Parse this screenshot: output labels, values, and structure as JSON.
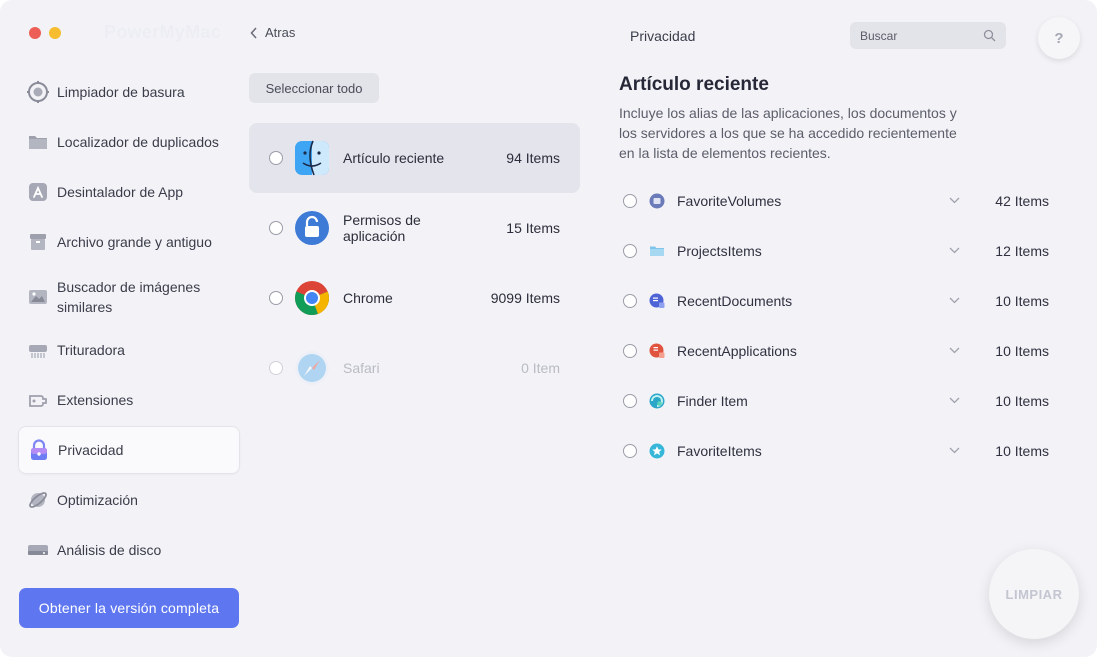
{
  "app": {
    "name": "PowerMyMac"
  },
  "nav": {
    "back_label": "Atras",
    "page_title": "Privacidad"
  },
  "search": {
    "placeholder": "Buscar"
  },
  "help": {
    "label": "?"
  },
  "sidebar": {
    "items": [
      {
        "label": "Limpiador de basura",
        "icon": "cleaner-icon"
      },
      {
        "label": "Localizador de duplicados",
        "icon": "folder-icon"
      },
      {
        "label": "Desintalador de App",
        "icon": "app-store-icon"
      },
      {
        "label": "Archivo grande y antiguo",
        "icon": "archive-box-icon"
      },
      {
        "label": "Buscador de imágenes similares",
        "icon": "image-icon"
      },
      {
        "label": "Trituradora",
        "icon": "shredder-icon"
      },
      {
        "label": "Extensiones",
        "icon": "extension-icon"
      },
      {
        "label": "Privacidad",
        "icon": "lock-icon",
        "active": true
      },
      {
        "label": "Optimización",
        "icon": "optimize-icon"
      },
      {
        "label": "Análisis de disco",
        "icon": "disk-icon"
      }
    ],
    "upgrade_label": "Obtener la versión completa"
  },
  "middle": {
    "select_all_label": "Seleccionar todo",
    "rows": [
      {
        "label": "Artículo reciente",
        "count": "94 Items",
        "icon": "finder-icon",
        "selected": true
      },
      {
        "label": "Permisos de aplicación",
        "count": "15 Items",
        "icon": "lock-icon"
      },
      {
        "label": "Chrome",
        "count": "9099 Items",
        "icon": "chrome-icon"
      },
      {
        "label": "Safari",
        "count": "0 Item",
        "icon": "safari-icon",
        "disabled": true
      }
    ]
  },
  "detail": {
    "title": "Artículo reciente",
    "description": "Incluye los alias de las aplicaciones, los documentos y los servidores a los que se ha accedido recientemente en la lista de elementos recientes.",
    "rows": [
      {
        "label": "FavoriteVolumes",
        "count": "42 Items",
        "icon": "volume-icon"
      },
      {
        "label": "ProjectsItems",
        "count": "12 Items",
        "icon": "folder-icon"
      },
      {
        "label": "RecentDocuments",
        "count": "10 Items",
        "icon": "document-icon"
      },
      {
        "label": "RecentApplications",
        "count": "10 Items",
        "icon": "application-icon"
      },
      {
        "label": "Finder Item",
        "count": "10 Items",
        "icon": "finder-item-icon"
      },
      {
        "label": "FavoriteItems",
        "count": "10 Items",
        "icon": "star-icon"
      }
    ]
  },
  "actions": {
    "clean_label": "LIMPIAR"
  },
  "colors": {
    "accent": "#5e77f0",
    "background": "#f3f3f7",
    "selected_row": "#e3e4ec"
  }
}
